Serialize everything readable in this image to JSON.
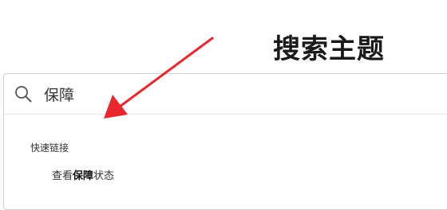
{
  "annotation": {
    "title": "搜索主题",
    "arrow_color": "#e8262b"
  },
  "search": {
    "value": "保障",
    "icon": "search-icon"
  },
  "quick_links": {
    "section_title": "快速链接",
    "items": [
      {
        "prefix": "查看",
        "highlight": "保障",
        "suffix": "状态"
      }
    ]
  }
}
